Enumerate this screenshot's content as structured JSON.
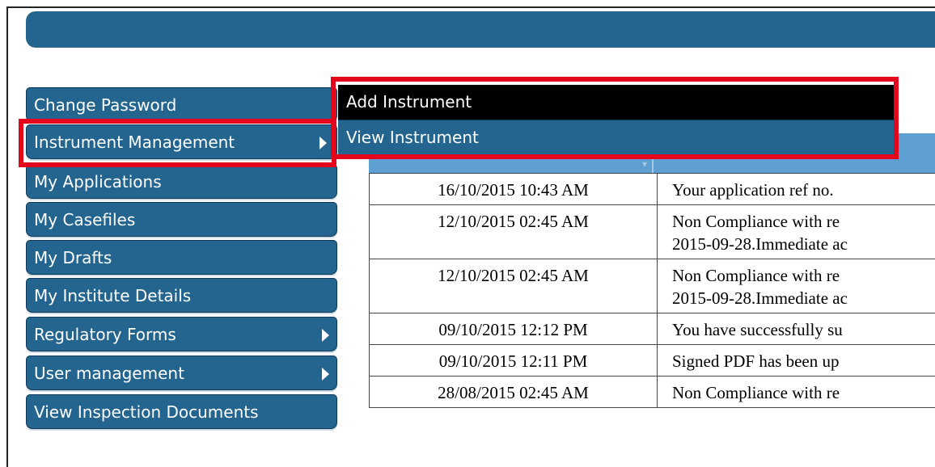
{
  "sidebar": {
    "items": [
      {
        "label": "Change Password",
        "has_submenu": false
      },
      {
        "label": "Instrument Management",
        "has_submenu": true
      },
      {
        "label": "My Applications",
        "has_submenu": false
      },
      {
        "label": "My Casefiles",
        "has_submenu": false
      },
      {
        "label": "My Drafts",
        "has_submenu": false
      },
      {
        "label": "My Institute Details",
        "has_submenu": false
      },
      {
        "label": "Regulatory Forms",
        "has_submenu": true
      },
      {
        "label": "User management",
        "has_submenu": true
      },
      {
        "label": "View Inspection Documents",
        "has_submenu": false
      }
    ]
  },
  "submenu": {
    "items": [
      "Add Instrument",
      "View Instrument"
    ]
  },
  "notifications": {
    "rows": [
      {
        "date": "16/10/2015 10:43 AM",
        "lines": [
          "Your application ref no."
        ]
      },
      {
        "date": "12/10/2015 02:45 AM",
        "lines": [
          "Non Compliance with re",
          "2015-09-28.Immediate ac"
        ]
      },
      {
        "date": "12/10/2015 02:45 AM",
        "lines": [
          "Non Compliance with re",
          "2015-09-28.Immediate ac"
        ]
      },
      {
        "date": "09/10/2015 12:12 PM",
        "lines": [
          "You have successfully su"
        ]
      },
      {
        "date": "09/10/2015 12:11 PM",
        "lines": [
          "Signed PDF has been up"
        ]
      },
      {
        "date": "28/08/2015 02:45 AM",
        "lines": [
          "Non Compliance with re"
        ]
      }
    ]
  },
  "colors": {
    "menu_blue": "#23658f",
    "table_header": "#5d9fd1",
    "highlight_red": "#e3061c"
  }
}
